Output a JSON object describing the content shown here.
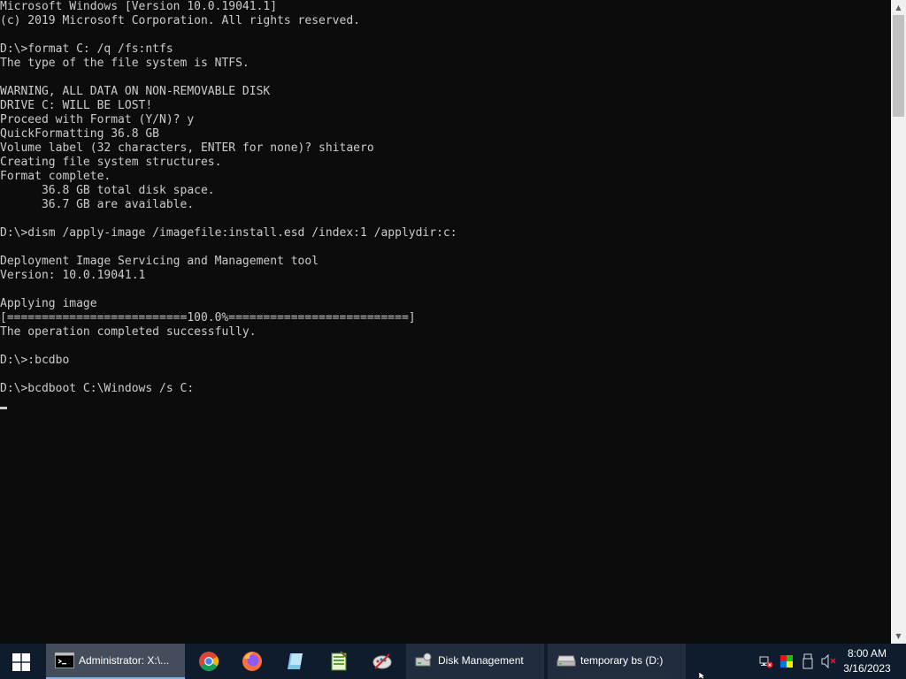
{
  "console": {
    "lines": [
      "Microsoft Windows [Version 10.0.19041.1]",
      "(c) 2019 Microsoft Corporation. All rights reserved.",
      "",
      "D:\\>format C: /q /fs:ntfs",
      "The type of the file system is NTFS.",
      "",
      "WARNING, ALL DATA ON NON-REMOVABLE DISK",
      "DRIVE C: WILL BE LOST!",
      "Proceed with Format (Y/N)? y",
      "QuickFormatting 36.8 GB",
      "Volume label (32 characters, ENTER for none)? shitaero",
      "Creating file system structures.",
      "Format complete.",
      "      36.8 GB total disk space.",
      "      36.7 GB are available.",
      "",
      "D:\\>dism /apply-image /imagefile:install.esd /index:1 /applydir:c:",
      "",
      "Deployment Image Servicing and Management tool",
      "Version: 10.0.19041.1",
      "",
      "Applying image",
      "[==========================100.0%==========================]",
      "The operation completed successfully.",
      "",
      "D:\\>:bcdbo",
      "",
      "D:\\>bcdboot C:\\Windows /s C:"
    ]
  },
  "taskbar": {
    "start_icon": "windows-logo-icon",
    "tasks": [
      {
        "label": "Administrator: X:\\...",
        "icon": "cmd-icon",
        "active": true
      },
      {
        "label": "Disk Management",
        "icon": "disk-management-icon",
        "active": false
      },
      {
        "label": "temporary bs (D:)",
        "icon": "drive-icon",
        "active": false
      }
    ],
    "pinned": [
      "chrome-icon",
      "firefox-icon",
      "notepad-icon",
      "spreadsheet-icon",
      "paint-icon"
    ],
    "tray": {
      "icons": [
        "network-icon",
        "color-icon",
        "usb-icon",
        "volume-muted-icon"
      ],
      "time": "8:00 AM",
      "date": "3/16/2023"
    }
  }
}
